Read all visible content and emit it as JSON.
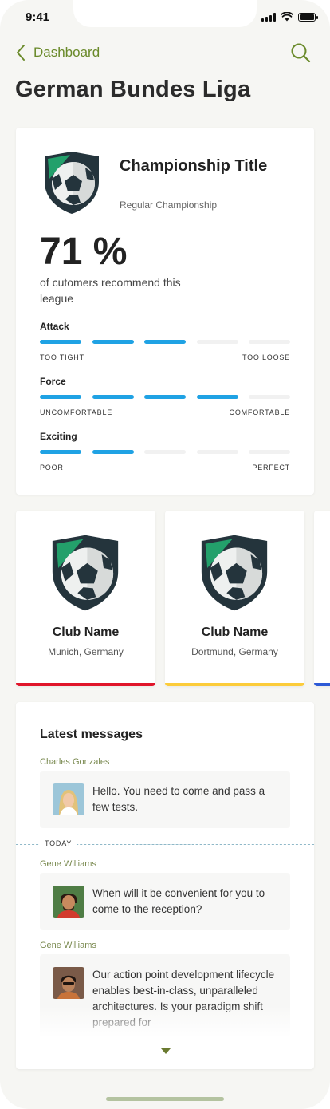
{
  "status_bar": {
    "time": "9:41"
  },
  "nav": {
    "back_label": "Dashboard"
  },
  "page": {
    "title": "German Bundes Liga"
  },
  "championship": {
    "title": "Championship Title",
    "subtitle": "Regular Championship",
    "percent": "71 %",
    "description": "of cutomers recommend this league",
    "metrics": [
      {
        "label": "Attack",
        "level": 3,
        "of": 5,
        "low": "TOO TIGHT",
        "high": "TOO LOOSE"
      },
      {
        "label": "Force",
        "level": 4,
        "of": 5,
        "low": "UNCOMFORTABLE",
        "high": "COMFORTABLE"
      },
      {
        "label": "Exciting",
        "level": 2,
        "of": 5,
        "low": "POOR",
        "high": "PERFECT"
      }
    ]
  },
  "clubs": [
    {
      "name": "Club Name",
      "city": "Munich, Germany",
      "color": "#e0152a"
    },
    {
      "name": "Club Name",
      "city": "Dortmund, Germany",
      "color": "#fccc3a"
    },
    {
      "name": "",
      "city": "",
      "color": "#2d5ad6"
    }
  ],
  "messages": {
    "title": "Latest messages",
    "divider": "TODAY",
    "items": [
      {
        "sender": "Charles Gonzales",
        "text": "Hello. You need to come and pass a few tests."
      },
      {
        "sender": "Gene Williams",
        "text": "When will it be convenient for you to come to the reception?"
      },
      {
        "sender": "Gene Williams",
        "text": "Our action point development lifecycle enables best-in-class, unparalleled architectures. Is your paradigm shift prepared for"
      }
    ]
  },
  "colors": {
    "accent": "#6a8a2a",
    "bar_active": "#1fa2e4",
    "logo_green": "#23a06b",
    "logo_dark": "#24343c"
  }
}
